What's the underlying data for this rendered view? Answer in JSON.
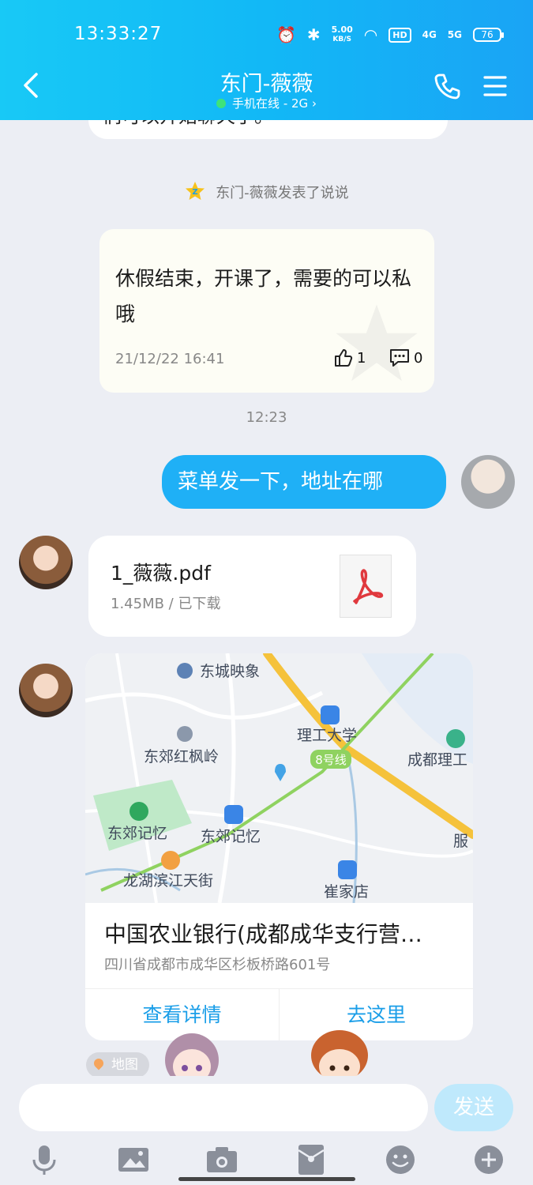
{
  "status_bar": {
    "time": "13:33:27",
    "speed_value": "5.00",
    "speed_unit": "KB/S",
    "hd": "HD",
    "net_4g": "4G",
    "net_5g": "5G",
    "battery": "76"
  },
  "header": {
    "title": "东门-薇薇",
    "status": "手机在线 - 2G",
    "status_chevron": "›"
  },
  "messages": {
    "top_partial": "们可以开始聊天了。",
    "system_notice": "东门-薇薇发表了说说",
    "post": {
      "text": "休假结束，开课了，需要的可以私哦",
      "date": "21/12/22 16:41",
      "likes": "1",
      "comments": "0"
    },
    "time_separator": "12:23",
    "outgoing_text": "菜单发一下，地址在哪",
    "file": {
      "name": "1_薇薇.pdf",
      "meta": "1.45MB / 已下载"
    },
    "location": {
      "name": "中国农业银行(成都成华支行营…",
      "address": "四川省成都市成华区杉板桥路601号",
      "detail_button": "查看详情",
      "go_button": "去这里",
      "map_labels": {
        "l1": "东城映象",
        "l2": "理工大学",
        "l3": "东郊红枫岭",
        "l4": "8号线",
        "l5": "成都理工",
        "l6": "东郊记忆",
        "l7": "东郊记忆",
        "l8": "龙湖滨江天街",
        "l9": "崔家店",
        "l10": "服"
      }
    },
    "map_tag": "地图"
  },
  "input": {
    "value": "",
    "send_label": "发送"
  },
  "colors": {
    "header_start": "#18c9f6",
    "header_end": "#1aa4f5",
    "outgoing_bubble": "#1fb0f6",
    "link_blue": "#1a9ee8",
    "send_disabled": "#bfe9fc"
  },
  "icons": [
    "back-arrow-icon",
    "phone-icon",
    "menu-icon",
    "voice-icon",
    "image-icon",
    "camera-icon",
    "red-packet-icon",
    "emoji-icon",
    "plus-icon"
  ]
}
